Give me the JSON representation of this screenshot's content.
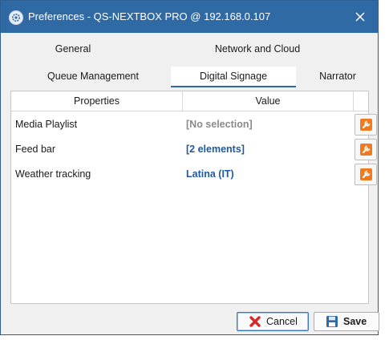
{
  "window": {
    "title": "Preferences - QS-NEXTBOX PRO @ 192.168.0.107"
  },
  "tabs": {
    "general": "General",
    "network": "Network and Cloud",
    "queue": "Queue Management",
    "signage": "Digital Signage",
    "narrator": "Narrator",
    "active": "Digital Signage"
  },
  "grid": {
    "col_properties": "Properties",
    "col_value": "Value",
    "rows": [
      {
        "property": "Media Playlist",
        "value": "[No selection]",
        "value_style": "muted"
      },
      {
        "property": "Feed bar",
        "value": "[2 elements]",
        "value_style": "link"
      },
      {
        "property": "Weather tracking",
        "value": "Latina (IT)",
        "value_style": "link"
      }
    ]
  },
  "buttons": {
    "cancel": "Cancel",
    "save": "Save"
  },
  "colors": {
    "titlebar": "#2f6aa5",
    "accent_blue": "#1e5aa0",
    "edit_orange": "#f07a1f",
    "cancel_red": "#d42a2a"
  },
  "icons": {
    "app": "gear-icon",
    "close": "close-icon",
    "edit": "wrench-icon",
    "cancel": "x-icon",
    "save": "floppy-disk-icon"
  }
}
